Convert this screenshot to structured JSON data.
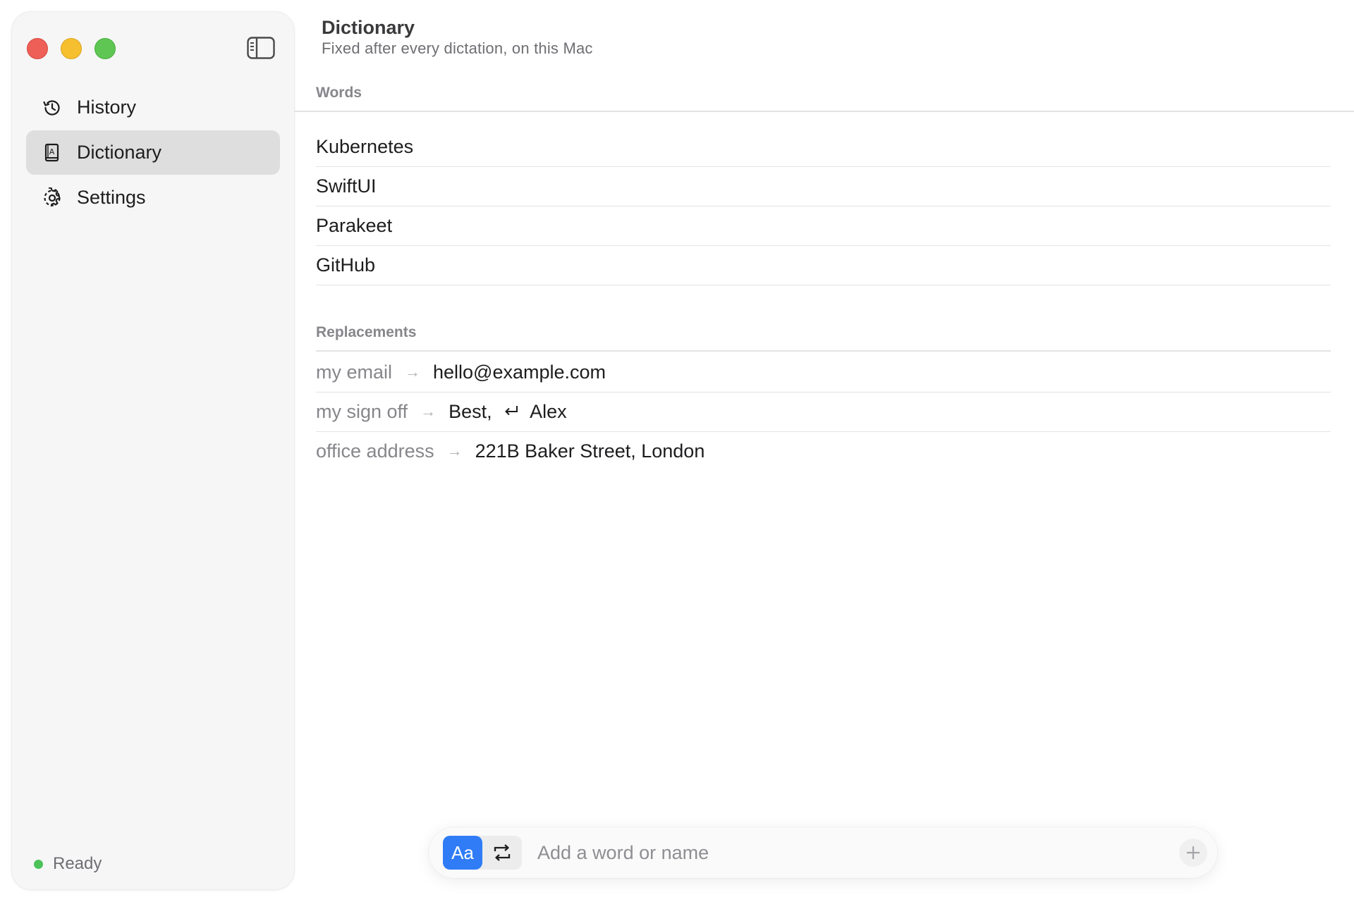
{
  "window": {
    "traffic_lights": [
      "close",
      "minimize",
      "zoom"
    ]
  },
  "sidebar": {
    "toggle_icon": "sidebar-toggle-icon",
    "items": [
      {
        "label": "History",
        "icon": "history-icon",
        "active": false
      },
      {
        "label": "Dictionary",
        "icon": "dictionary-book-icon",
        "active": true
      },
      {
        "label": "Settings",
        "icon": "gear-icon",
        "active": false
      }
    ],
    "status": {
      "label": "Ready",
      "color": "#4cc259"
    }
  },
  "header": {
    "title": "Dictionary",
    "subtitle": "Fixed after every dictation, on this Mac"
  },
  "words": {
    "heading": "Words",
    "items": [
      "Kubernetes",
      "SwiftUI",
      "Parakeet",
      "GitHub"
    ]
  },
  "replacements": {
    "heading": "Replacements",
    "arrow": "→",
    "items": [
      {
        "from": "my email",
        "to_before": "hello@example.com",
        "to_after": "",
        "has_return": false
      },
      {
        "from": "my sign off",
        "to_before": "Best,",
        "to_after": "Alex",
        "has_return": true
      },
      {
        "from": "office address",
        "to_before": "221B Baker Street, London",
        "to_after": "",
        "has_return": false
      }
    ]
  },
  "add_bar": {
    "mode_word_label": "Aa",
    "mode_replace_icon": "swap-arrows-icon",
    "placeholder": "Add a word or name",
    "add_icon": "plus-icon",
    "accent": "#2f7cf6"
  }
}
